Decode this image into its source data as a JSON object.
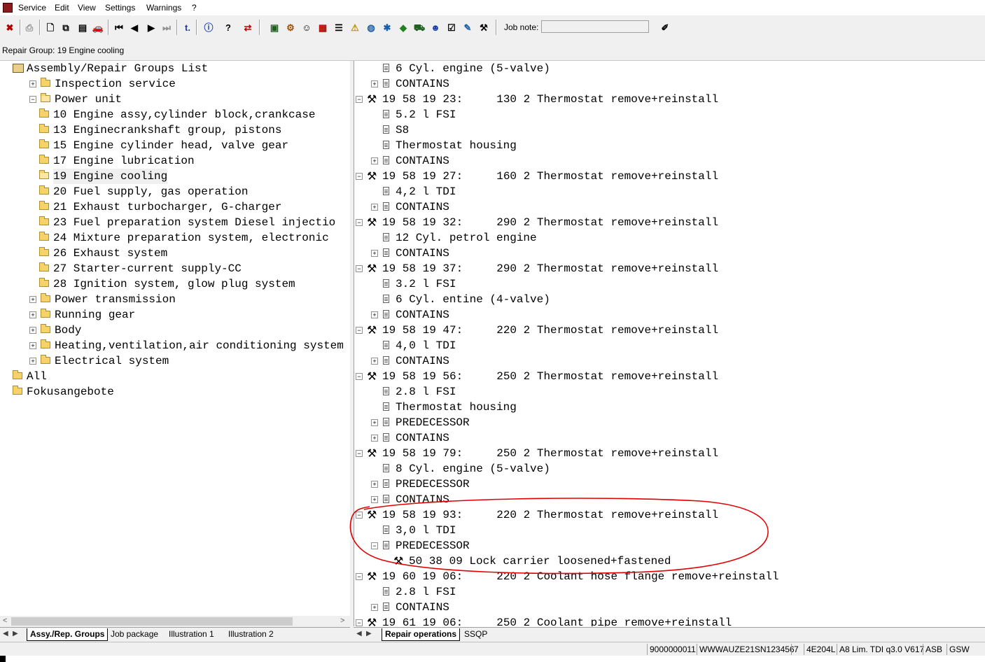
{
  "menu": [
    "Service",
    "Edit",
    "View",
    "Settings",
    "Warnings",
    "?"
  ],
  "toolbar": {
    "icons": [
      "print-icon",
      "new-icon",
      "copy-icon",
      "document-icon",
      "car-icon",
      "first-icon",
      "prev-icon",
      "next-icon",
      "last-icon",
      "t-link-icon",
      "info-icon",
      "help-icon",
      "swap-icon",
      "book-icon",
      "parts-icon",
      "person-icon",
      "manual-icon",
      "list-icon",
      "warning-icon",
      "globe-icon",
      "green-icon",
      "vehicle-icon",
      "user-icon",
      "checklist-icon",
      "notes-icon",
      "tools-icon"
    ],
    "job_note_label": "Job note:",
    "job_note_value": ""
  },
  "repair_group_label": "Repair Group: 19 Engine cooling",
  "left_tree": [
    {
      "label": "Assembly/Repair Groups List",
      "indent": 0,
      "icon": "book",
      "pm": "-"
    },
    {
      "label": "Inspection service",
      "indent": 1,
      "icon": "folder",
      "pm": "+"
    },
    {
      "label": "Power unit",
      "indent": 1,
      "icon": "folder-open",
      "pm": "-"
    },
    {
      "label": "10 Engine assy,cylinder block,crankcase",
      "indent": 2,
      "icon": "folder",
      "pm": ""
    },
    {
      "label": "13 Enginecrankshaft group, pistons",
      "indent": 2,
      "icon": "folder",
      "pm": ""
    },
    {
      "label": "15 Engine cylinder head, valve gear",
      "indent": 2,
      "icon": "folder",
      "pm": ""
    },
    {
      "label": "17 Engine lubrication",
      "indent": 2,
      "icon": "folder",
      "pm": ""
    },
    {
      "label": "19 Engine cooling",
      "indent": 2,
      "icon": "folder-open",
      "pm": "",
      "selected": true
    },
    {
      "label": "20 Fuel supply, gas operation",
      "indent": 2,
      "icon": "folder",
      "pm": ""
    },
    {
      "label": "21 Exhaust turbocharger, G-charger",
      "indent": 2,
      "icon": "folder",
      "pm": ""
    },
    {
      "label": "23 Fuel preparation system Diesel injectio",
      "indent": 2,
      "icon": "folder",
      "pm": ""
    },
    {
      "label": "24 Mixture preparation system, electronic",
      "indent": 2,
      "icon": "folder",
      "pm": ""
    },
    {
      "label": "26 Exhaust system",
      "indent": 2,
      "icon": "folder",
      "pm": ""
    },
    {
      "label": "27 Starter-current supply-CC",
      "indent": 2,
      "icon": "folder",
      "pm": ""
    },
    {
      "label": "28 Ignition system, glow plug system",
      "indent": 2,
      "icon": "folder",
      "pm": ""
    },
    {
      "label": "Power transmission",
      "indent": 1,
      "icon": "folder",
      "pm": "+"
    },
    {
      "label": "Running gear",
      "indent": 1,
      "icon": "folder",
      "pm": "+"
    },
    {
      "label": "Body",
      "indent": 1,
      "icon": "folder",
      "pm": "+"
    },
    {
      "label": "Heating,ventilation,air conditioning system",
      "indent": 1,
      "icon": "folder",
      "pm": "+"
    },
    {
      "label": "Electrical system",
      "indent": 1,
      "icon": "folder",
      "pm": "+"
    },
    {
      "label": "All",
      "indent": 0,
      "icon": "folders",
      "pm": ""
    },
    {
      "label": "Fokusangebote",
      "indent": 0,
      "icon": "folders",
      "pm": ""
    }
  ],
  "right_tree": [
    {
      "label": "6 Cyl. engine (5-valve)",
      "type": "doc",
      "pm": ""
    },
    {
      "label": "CONTAINS",
      "type": "doc",
      "pm": "+"
    },
    {
      "label": "19 58 19 23:     130 2 Thermostat remove+reinstall",
      "type": "op",
      "pm": "-"
    },
    {
      "label": "5.2 l FSI",
      "type": "doc",
      "pm": ""
    },
    {
      "label": "S8",
      "type": "doc",
      "pm": ""
    },
    {
      "label": "Thermostat housing",
      "type": "doc",
      "pm": ""
    },
    {
      "label": "CONTAINS",
      "type": "doc",
      "pm": "+"
    },
    {
      "label": "19 58 19 27:     160 2 Thermostat remove+reinstall",
      "type": "op",
      "pm": "-"
    },
    {
      "label": "4,2 l TDI",
      "type": "doc",
      "pm": ""
    },
    {
      "label": "CONTAINS",
      "type": "doc",
      "pm": "+"
    },
    {
      "label": "19 58 19 32:     290 2 Thermostat remove+reinstall",
      "type": "op",
      "pm": "-"
    },
    {
      "label": "12 Cyl. petrol engine",
      "type": "doc",
      "pm": ""
    },
    {
      "label": "CONTAINS",
      "type": "doc",
      "pm": "+"
    },
    {
      "label": "19 58 19 37:     290 2 Thermostat remove+reinstall",
      "type": "op",
      "pm": "-"
    },
    {
      "label": "3.2 l FSI",
      "type": "doc",
      "pm": ""
    },
    {
      "label": "6 Cyl. entine (4-valve)",
      "type": "doc",
      "pm": ""
    },
    {
      "label": "CONTAINS",
      "type": "doc",
      "pm": "+"
    },
    {
      "label": "19 58 19 47:     220 2 Thermostat remove+reinstall",
      "type": "op",
      "pm": "-"
    },
    {
      "label": "4,0 l TDI",
      "type": "doc",
      "pm": ""
    },
    {
      "label": "CONTAINS",
      "type": "doc",
      "pm": "+"
    },
    {
      "label": "19 58 19 56:     250 2 Thermostat remove+reinstall",
      "type": "op",
      "pm": "-"
    },
    {
      "label": "2.8 l FSI",
      "type": "doc",
      "pm": ""
    },
    {
      "label": "Thermostat housing",
      "type": "doc",
      "pm": ""
    },
    {
      "label": "PREDECESSOR",
      "type": "doc",
      "pm": "+"
    },
    {
      "label": "CONTAINS",
      "type": "doc",
      "pm": "+"
    },
    {
      "label": "19 58 19 79:     250 2 Thermostat remove+reinstall",
      "type": "op",
      "pm": "-"
    },
    {
      "label": "8 Cyl. engine (5-valve)",
      "type": "doc",
      "pm": ""
    },
    {
      "label": "PREDECESSOR",
      "type": "doc",
      "pm": "+"
    },
    {
      "label": "CONTAINS",
      "type": "doc",
      "pm": "+"
    },
    {
      "label": "19 58 19 93:     220 2 Thermostat remove+reinstall",
      "type": "op",
      "pm": "-"
    },
    {
      "label": "3,0 l TDI",
      "type": "doc",
      "pm": ""
    },
    {
      "label": "PREDECESSOR",
      "type": "doc",
      "pm": "-"
    },
    {
      "label": "50 38 09 Lock carrier loosened+fastened",
      "type": "subop",
      "pm": ""
    },
    {
      "label": "19 60 19 06:     220 2 Coolant hose flange remove+reinstall",
      "type": "op",
      "pm": "-"
    },
    {
      "label": "2.8 l FSI",
      "type": "doc",
      "pm": ""
    },
    {
      "label": "CONTAINS",
      "type": "doc",
      "pm": "+"
    },
    {
      "label": "19 61 19 06:     250 2 Coolant pipe remove+reinstall",
      "type": "op",
      "pm": "-"
    }
  ],
  "left_tabs": [
    "Assy./Rep. Groups",
    "Job package",
    "Illustration 1",
    "Illustration 2"
  ],
  "right_tabs": [
    "Repair operations",
    "SSQP"
  ],
  "status": [
    "9000000011",
    "WWWAUZE21SN123456",
    "7",
    "4E204L",
    "A8 Lim. TDI q3.0 V617",
    "ASB",
    "GSW"
  ],
  "colors": {
    "annotation": "#e00000",
    "selection": "#f0f0f0"
  }
}
